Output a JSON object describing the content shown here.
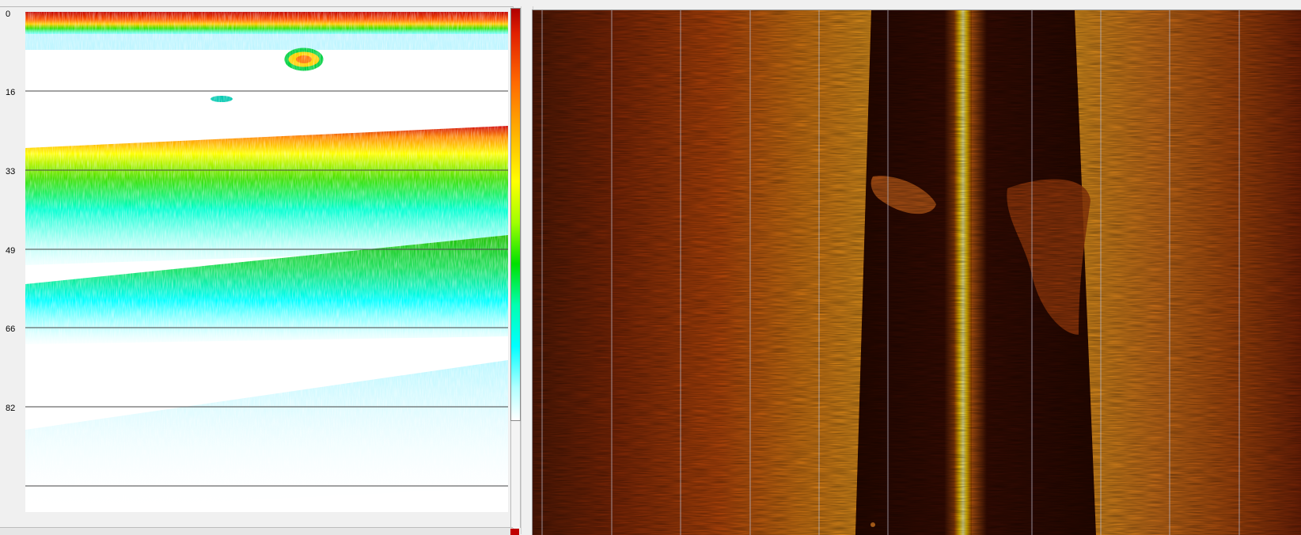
{
  "echogram": {
    "depth_scale": [
      "0",
      "16",
      "33",
      "49",
      "66",
      "82"
    ],
    "palette": [
      "#b00000",
      "#ff6a00",
      "#ffff00",
      "#00e000",
      "#00ffff",
      "#ffffff"
    ]
  },
  "sidescan": {
    "palette": [
      "#2a0800",
      "#8a2a05",
      "#d06010",
      "#f0a020",
      "#fff060"
    ]
  }
}
